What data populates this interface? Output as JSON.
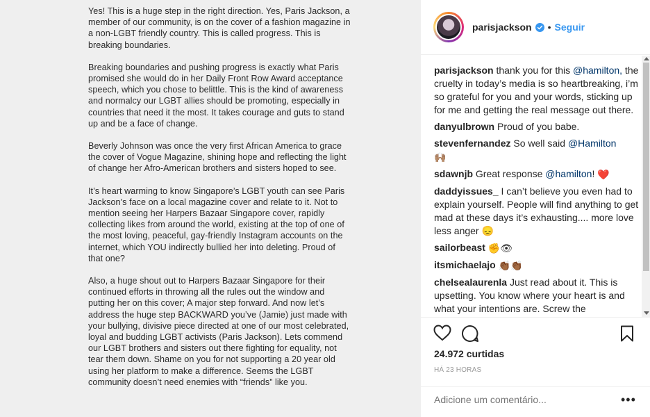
{
  "post_image": {
    "paragraphs": [
      "Yes! This is a huge step in the right direction. Yes, Paris Jackson, a member of our community, is on the cover of a fashion magazine in a non-LGBT friendly country. This is called progress. This is breaking boundaries.",
      "Breaking boundaries and pushing progress is exactly what Paris promised she would do in her Daily Front Row Award acceptance speech, which you chose to belittle. This is the kind of awareness and normalcy our LGBT allies should be promoting, especially in countries that need it the most. It takes courage and guts to stand up and be a face of change.",
      "Beverly Johnson was once the very first African America to grace the cover of Vogue Magazine, shining hope and reflecting the light of change her Afro-American brothers and sisters hoped to see.",
      "It’s heart warming to know Singapore’s LGBT youth can see Paris Jackson’s face on a local magazine cover and relate to it. Not to mention seeing her Harpers Bazaar Singapore cover, rapidly collecting likes from around the world, existing at the top of one of the most loving, peaceful, gay-friendly Instagram accounts on the internet, which YOU indirectly bullied her into deleting. Proud of that one?",
      "Also, a huge shout out to Harpers Bazaar Singapore for their continued efforts in throwing all the rules out the window and putting her on this cover; A major step forward. And now let’s address the huge step BACKWARD you’ve (Jamie) just made with your bullying, divisive piece directed at one of our most celebrated, loyal and budding LGBT activists (Paris Jackson). Lets commend our LGBT brothers and sisters out there fighting for equality, not tear them down. Shame on you for not supporting a 20 year old using her platform to make a difference. Seems the LGBT community doesn’t need enemies with “friends” like you."
    ]
  },
  "header": {
    "username": "parisjackson",
    "separator": "•",
    "follow_label": "Seguir"
  },
  "comments": [
    {
      "user": "parisjackson",
      "pre": "thank you for this ",
      "mention": "@hamilton,",
      "post": " the cruelty in today’s media is so heartbreaking, i’m so grateful for you and your words, sticking up for me and getting the real message out there.",
      "emoji": ""
    },
    {
      "user": "danyulbrown",
      "pre": "Proud of you babe.",
      "mention": "",
      "post": "",
      "emoji": ""
    },
    {
      "user": "stevenfernandez",
      "pre": "So well said ",
      "mention": "@Hamilton",
      "post": "",
      "emoji": "🙌🏽"
    },
    {
      "user": "sdawnjb",
      "pre": "Great response ",
      "mention": "@hamilton",
      "post": "! ",
      "emoji": "❤️"
    },
    {
      "user": "daddyissues_",
      "pre": "I can’t believe you even had to explain yourself. People will find anything to get mad at these days it’s exhausting.... more love less anger ",
      "mention": "",
      "post": "",
      "emoji": "😞"
    },
    {
      "user": "sailorbeast",
      "pre": "",
      "mention": "",
      "post": "",
      "emoji": "✊👁"
    },
    {
      "user": "itsmichaelajo",
      "pre": "",
      "mention": "",
      "post": "",
      "emoji": "👏🏾👏🏾"
    },
    {
      "user": "chelsealaurenla",
      "pre": "Just read about it. This is upsetting. You know where your heart is and what your intentions are. Screw the",
      "mention": "",
      "post": "",
      "emoji": ""
    }
  ],
  "actions": {
    "likes": "24.972 curtidas",
    "time": "HÁ 23 HORAS"
  },
  "add_comment": {
    "placeholder": "Adicione um comentário...",
    "more": "•••"
  },
  "colors": {
    "link": "#3897f0",
    "mention": "#003569",
    "muted": "#999999"
  }
}
